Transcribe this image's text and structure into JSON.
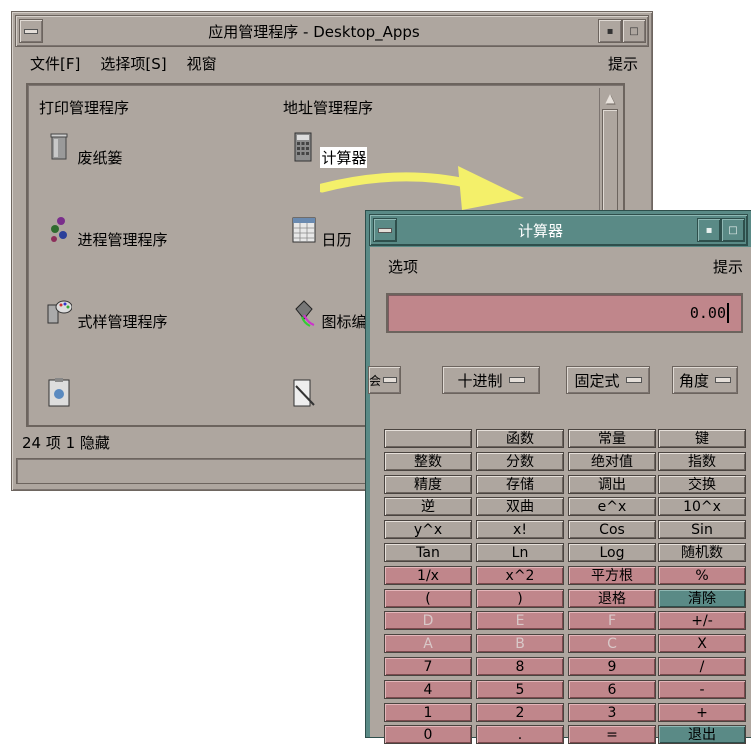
{
  "app_manager": {
    "title": "应用管理程序 - Desktop_Apps",
    "menu": [
      "文件[F]",
      "选择项[S]",
      "视窗"
    ],
    "help": "提示",
    "icons": [
      {
        "label": "打印管理程序",
        "icon": "printer-icon"
      },
      {
        "label": "地址管理程序",
        "icon": "address-icon"
      },
      {
        "label": "废纸篓",
        "icon": "trash-icon"
      },
      {
        "label": "计算器",
        "icon": "calculator-icon",
        "selected": true
      },
      {
        "label": "进程管理程序",
        "icon": "gears-icon"
      },
      {
        "label": "日历",
        "icon": "calendar-icon"
      },
      {
        "label": "式样管理程序",
        "icon": "palette-icon"
      },
      {
        "label": "图标编辑程序",
        "icon": "paint-bucket-icon"
      },
      {
        "label": "",
        "icon": "clipboard-icon"
      },
      {
        "label": "",
        "icon": "document-icon"
      }
    ],
    "status": "24 项 1 隐藏"
  },
  "calculator": {
    "title": "计算器",
    "menu": "选项",
    "help": "提示",
    "display": "0.00",
    "modes": [
      {
        "label": "会"
      },
      {
        "label": "十进制"
      },
      {
        "label": "固定式"
      },
      {
        "label": "角度"
      }
    ],
    "rows": [
      [
        {
          "l": "",
          "c": "gray"
        },
        {
          "l": "函数",
          "c": "gray"
        },
        {
          "l": "常量",
          "c": "gray"
        },
        {
          "l": "键",
          "c": "gray"
        }
      ],
      [
        {
          "l": "整数",
          "c": "gray"
        },
        {
          "l": "分数",
          "c": "gray"
        },
        {
          "l": "绝对值",
          "c": "gray"
        },
        {
          "l": "指数",
          "c": "gray"
        }
      ],
      [
        {
          "l": "精度",
          "c": "gray"
        },
        {
          "l": "存储",
          "c": "gray"
        },
        {
          "l": "调出",
          "c": "gray"
        },
        {
          "l": "交换",
          "c": "gray"
        }
      ],
      [
        {
          "l": "逆",
          "c": "gray"
        },
        {
          "l": "双曲",
          "c": "gray"
        },
        {
          "l": "e^x",
          "c": "gray"
        },
        {
          "l": "10^x",
          "c": "gray"
        }
      ],
      [
        {
          "l": "y^x",
          "c": "gray"
        },
        {
          "l": "x!",
          "c": "gray"
        },
        {
          "l": "Cos",
          "c": "gray"
        },
        {
          "l": "Sin",
          "c": "gray"
        }
      ],
      [
        {
          "l": "Tan",
          "c": "gray"
        },
        {
          "l": "Ln",
          "c": "gray"
        },
        {
          "l": "Log",
          "c": "gray"
        },
        {
          "l": "随机数",
          "c": "gray"
        }
      ],
      [
        {
          "l": "1/x",
          "c": "pink"
        },
        {
          "l": "x^2",
          "c": "pink"
        },
        {
          "l": "平方根",
          "c": "pink"
        },
        {
          "l": "%",
          "c": "pink"
        }
      ],
      [
        {
          "l": "(",
          "c": "pink"
        },
        {
          "l": ")",
          "c": "pink"
        },
        {
          "l": "退格",
          "c": "pink"
        },
        {
          "l": "清除",
          "c": "teal"
        }
      ],
      [
        {
          "l": "D",
          "c": "pink dim"
        },
        {
          "l": "E",
          "c": "pink dim"
        },
        {
          "l": "F",
          "c": "pink dim"
        },
        {
          "l": "+/-",
          "c": "pink"
        }
      ],
      [
        {
          "l": "A",
          "c": "pink dim"
        },
        {
          "l": "B",
          "c": "pink dim"
        },
        {
          "l": "C",
          "c": "pink dim"
        },
        {
          "l": "X",
          "c": "pink"
        }
      ],
      [
        {
          "l": "7",
          "c": "pink"
        },
        {
          "l": "8",
          "c": "pink"
        },
        {
          "l": "9",
          "c": "pink"
        },
        {
          "l": "/",
          "c": "pink"
        }
      ],
      [
        {
          "l": "4",
          "c": "pink"
        },
        {
          "l": "5",
          "c": "pink"
        },
        {
          "l": "6",
          "c": "pink"
        },
        {
          "l": "-",
          "c": "pink"
        }
      ],
      [
        {
          "l": "1",
          "c": "pink"
        },
        {
          "l": "2",
          "c": "pink"
        },
        {
          "l": "3",
          "c": "pink"
        },
        {
          "l": "+",
          "c": "pink"
        }
      ],
      [
        {
          "l": "0",
          "c": "pink"
        },
        {
          "l": ".",
          "c": "pink"
        },
        {
          "l": "=",
          "c": "pink"
        },
        {
          "l": "退出",
          "c": "teal"
        }
      ]
    ]
  },
  "colors": {
    "window_bg": "#aea69f",
    "calc_title": "#5a8a86",
    "key_pink": "#c0868b",
    "arrow": "#f4f06a"
  }
}
